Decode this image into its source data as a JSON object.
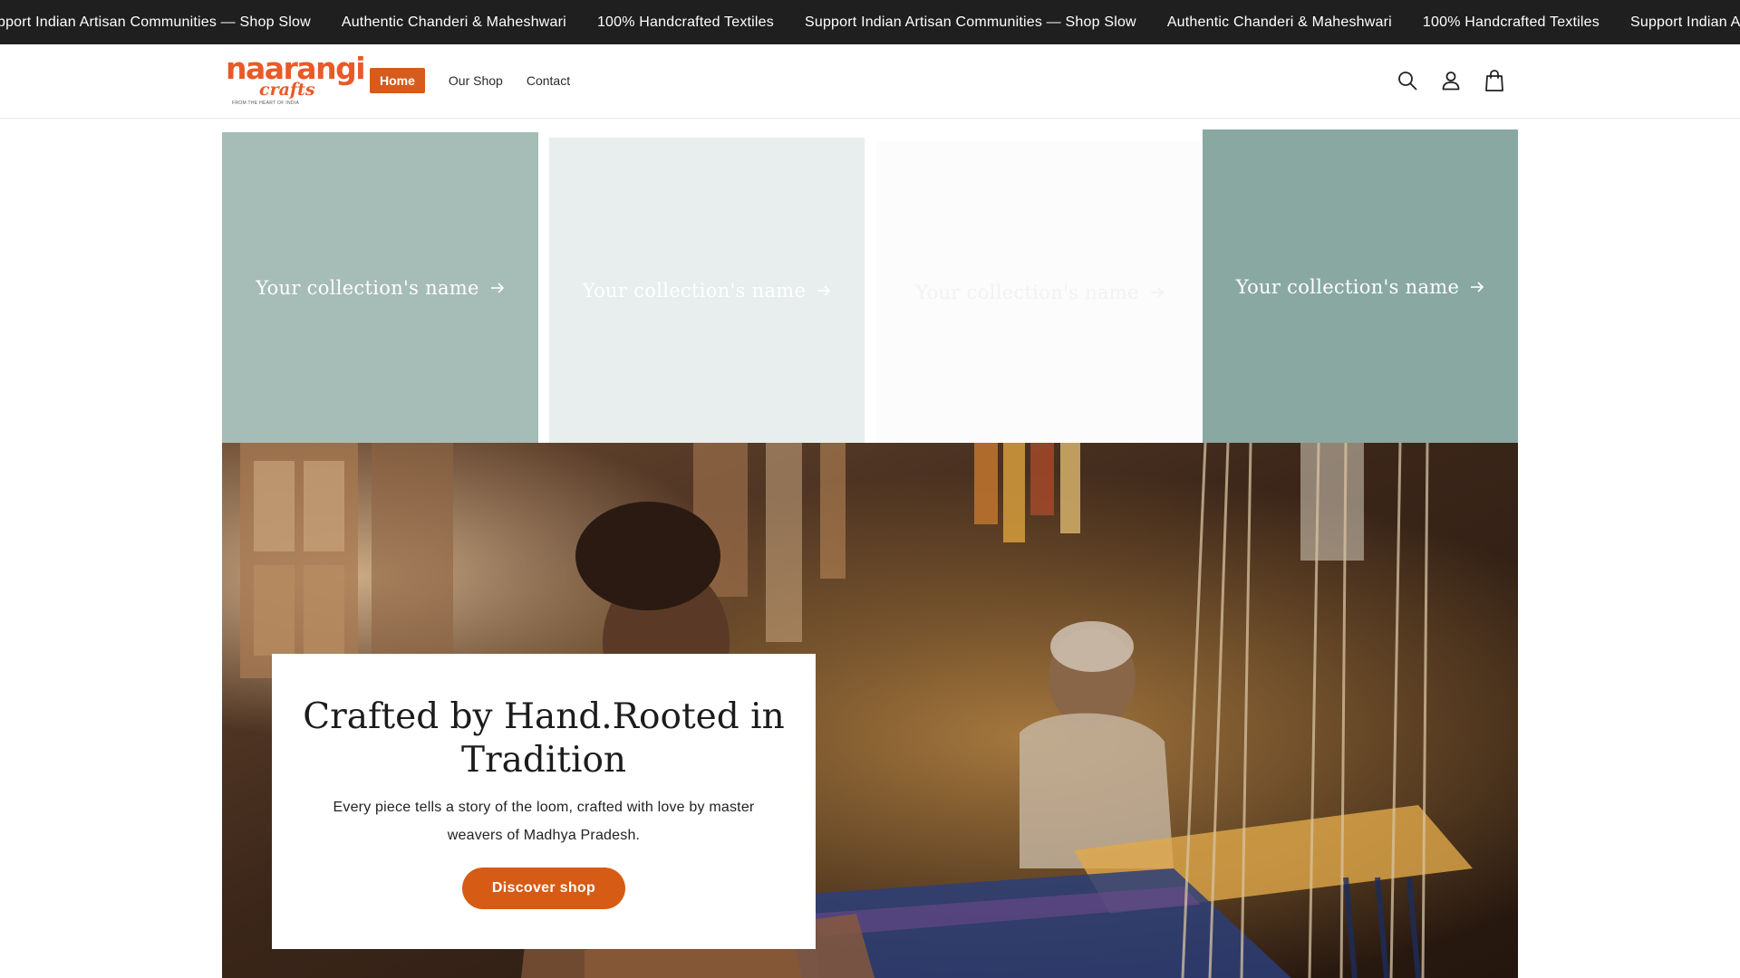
{
  "announcement_bar": {
    "items": [
      "Support Indian Artisan Communities — Shop Slow",
      "Authentic Chanderi & Maheshwari",
      "100% Handcrafted Textiles",
      "Support Indian Artisan Communities — Shop Slow",
      "Authentic Chanderi & Maheshwari",
      "100% Handcrafted Textiles",
      "Support Indian Artisan Communities — Shop Slow"
    ]
  },
  "header": {
    "logo": {
      "main": "naarangi",
      "sub": "crafts",
      "tagline": "FROM THE HEART OF INDIA"
    },
    "nav": [
      {
        "label": "Home",
        "active": true
      },
      {
        "label": "Our Shop",
        "active": false
      },
      {
        "label": "Contact",
        "active": false
      }
    ],
    "icons": [
      "search-icon",
      "account-icon",
      "cart-icon"
    ]
  },
  "collections": [
    {
      "label": "Your collection's name",
      "color": "#a6bcb7"
    },
    {
      "label": "Your collection's name",
      "color": "#e7eeed"
    },
    {
      "label": "Your collection's name",
      "color": "#fcfcfc"
    },
    {
      "label": "Your collection's name",
      "color": "#89a8a1"
    }
  ],
  "hero": {
    "title": "Crafted by Hand.Rooted in Tradition",
    "text": "Every piece tells a story of the loom, crafted with love by master weavers of Madhya Pradesh.",
    "button_label": "Discover shop"
  },
  "colors": {
    "accent": "#d65b14",
    "announcement_bg": "#1f1f1f",
    "logo": "#e95a27"
  }
}
